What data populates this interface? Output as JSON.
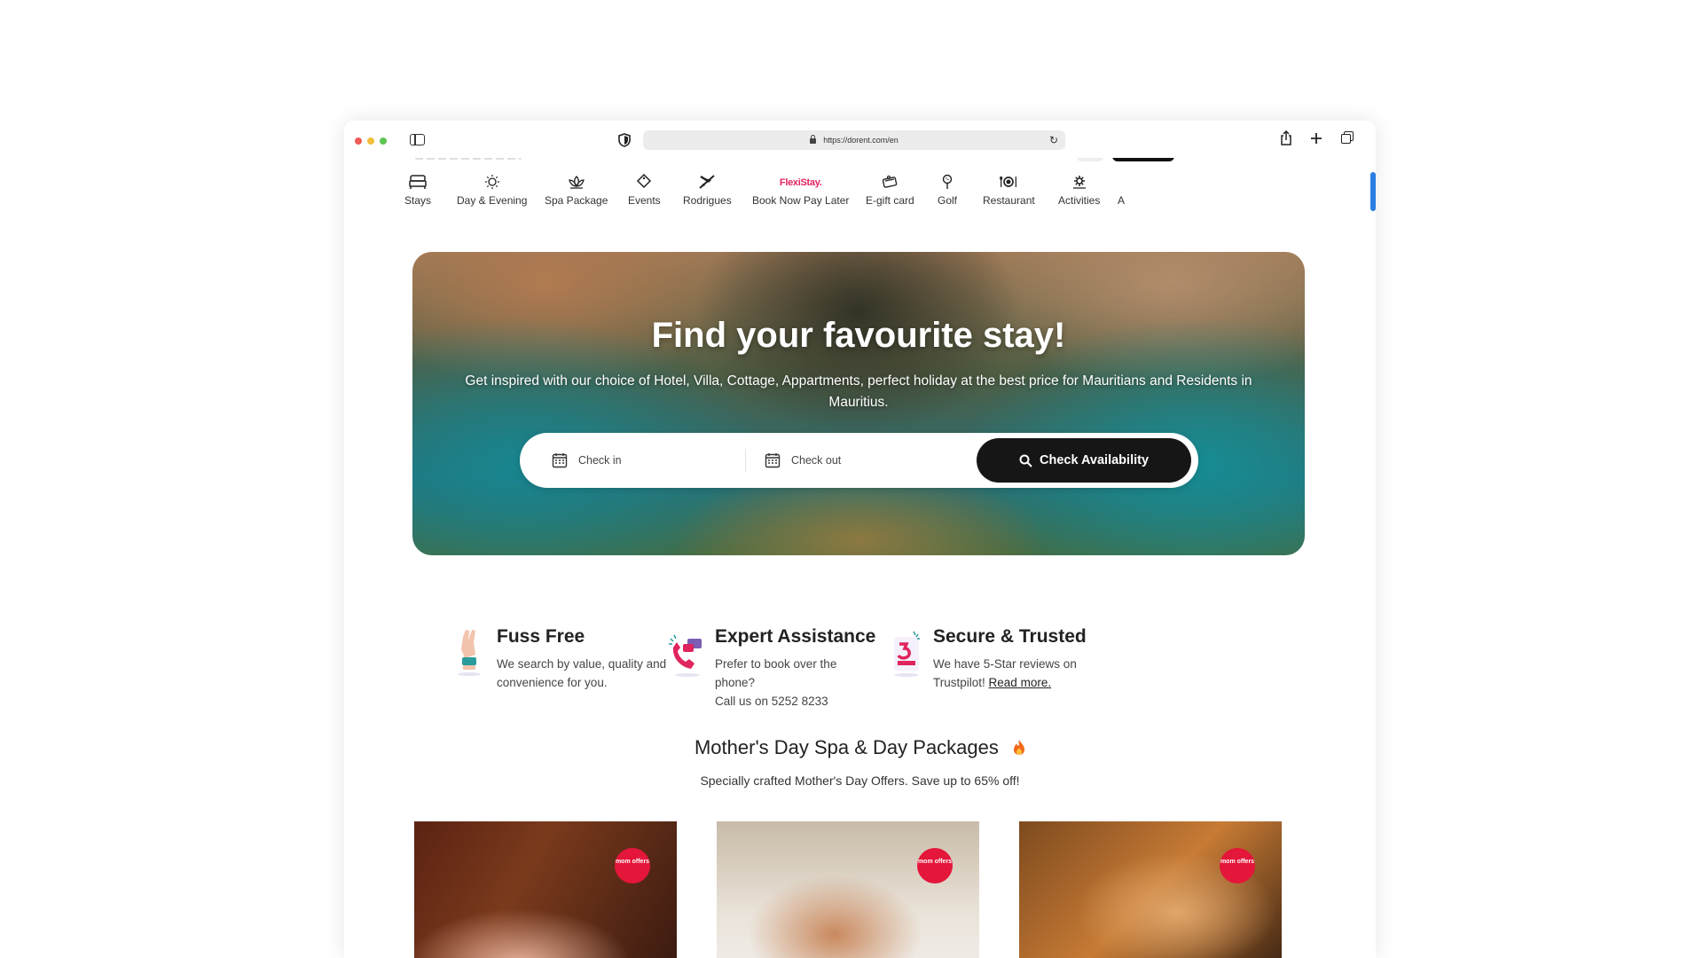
{
  "browser": {
    "url": "https://dorent.com/en"
  },
  "nav": {
    "items": [
      {
        "label": "Stays",
        "icon": "bed-icon"
      },
      {
        "label": "Day & Evening",
        "icon": "sun-icon"
      },
      {
        "label": "Spa Package",
        "icon": "lotus-icon"
      },
      {
        "label": "Events",
        "icon": "tag-icon"
      },
      {
        "label": "Rodrigues",
        "icon": "plane-icon"
      },
      {
        "label": "Book Now Pay Later",
        "icon": "flexistay-logo",
        "logo_text": "FlexiStay."
      },
      {
        "label": "E-gift card",
        "icon": "gift-card-icon"
      },
      {
        "label": "Golf",
        "icon": "golf-icon"
      },
      {
        "label": "Restaurant",
        "icon": "restaurant-icon"
      },
      {
        "label": "Activities",
        "icon": "activities-icon"
      },
      {
        "label": "A",
        "icon": ""
      }
    ]
  },
  "hero": {
    "title": "Find your favourite stay!",
    "subtitle": "Get inspired with our choice of Hotel, Villa, Cottage, Appartments, perfect holiday at the best price for Mauritians and Residents in Mauritius.",
    "check_in_placeholder": "Check in",
    "check_out_placeholder": "Check out",
    "button_label": "Check Availability"
  },
  "features": [
    {
      "title": "Fuss Free",
      "text": "We search by value, quality and convenience for you."
    },
    {
      "title": "Expert Assistance",
      "text_lines": [
        "Prefer to book over the",
        "phone?",
        "Call us on 5252 8233"
      ]
    },
    {
      "title": "Secure & Trusted",
      "text": "We have 5-Star reviews on Trustpilot!",
      "link": "Read more."
    }
  ],
  "section": {
    "title": "Mother's Day Spa & Day Packages",
    "subtitle": "Specially crafted Mother's Day Offers. Save up to 65% off!"
  },
  "cards": [
    {
      "badge": "mom offers"
    },
    {
      "badge": "mom offers"
    },
    {
      "badge": "mom offers"
    }
  ],
  "colors": {
    "accent_dark": "#161616",
    "badge_red": "#e4163a",
    "flexi_pink": "#e0245e",
    "scroll_blue": "#2a7de1"
  }
}
